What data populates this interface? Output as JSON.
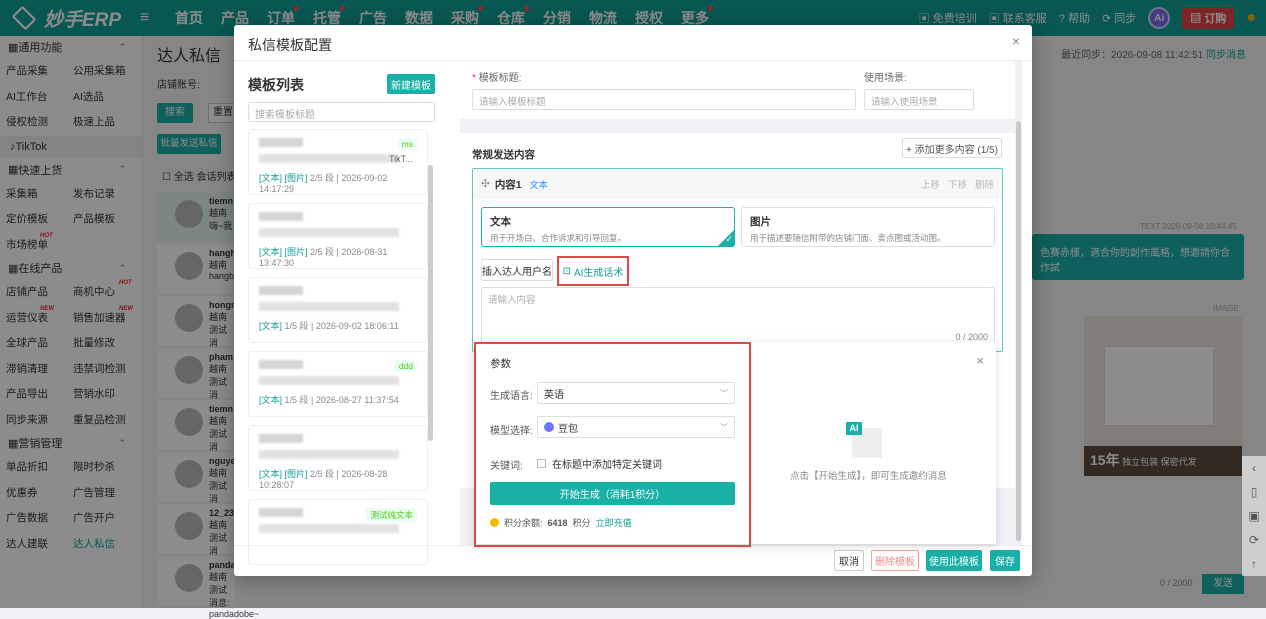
{
  "app": {
    "logo": "妙手ERP"
  },
  "topnav": [
    "首页",
    "产品",
    "订单",
    "托管",
    "广告",
    "数据",
    "采购",
    "仓库",
    "分销",
    "物流",
    "授权",
    "更多"
  ],
  "topright": {
    "training": "免费培训",
    "service": "联系客服",
    "help": "帮助",
    "sync": "同步",
    "ai": "Ai",
    "subscribe": "订购"
  },
  "sidebar": {
    "sections": [
      {
        "title": "通用功能",
        "rows": [
          [
            "产品采集",
            "公用采集箱"
          ],
          [
            "AI工作台",
            "AI选品"
          ],
          [
            "侵权检测",
            "极速上品"
          ]
        ]
      },
      {
        "title": "TikTok",
        "rows": []
      },
      {
        "title": "快速上货",
        "rows": [
          [
            "采集箱",
            "发布记录"
          ],
          [
            "定价模板",
            "产品模板"
          ],
          [
            "市场榜单",
            ""
          ]
        ]
      },
      {
        "title": "在线产品",
        "rows": [
          [
            "店铺产品",
            "商机中心"
          ],
          [
            "运营仪表",
            "销售加速器"
          ],
          [
            "全球产品",
            "批量修改"
          ],
          [
            "滞销清理",
            "违禁词检测"
          ],
          [
            "产品导出",
            "营销水印"
          ],
          [
            "同步来源",
            "重复品检测"
          ]
        ]
      },
      {
        "title": "营销管理",
        "rows": [
          [
            "单品折扣",
            "限时秒杀"
          ],
          [
            "优惠券",
            "广告管理"
          ],
          [
            "广告数据",
            "广告开户"
          ],
          [
            "达人建联",
            "达人私信"
          ]
        ]
      }
    ],
    "badges": {
      "hot": "HOT",
      "new": "NEW"
    }
  },
  "background": {
    "page_title": "达人私信",
    "last_sync": "最近同步：2026-09-08 11:42:51",
    "sync_link": "同步消息",
    "shop_label": "店铺账号:",
    "search": "搜索",
    "reset": "重置",
    "batch_send": "批量发送私信",
    "select_all": "全选",
    "conv_list": "会话列表",
    "chat_ts": "TEXT 2026-09-08 10:44:45",
    "chat_text": "色赛赤樣，適合你的創作風格，想邀請你合作試",
    "image_label": "IMAGE",
    "counter": "0 / 2000",
    "send": "发送",
    "promo": "15年",
    "promo_a": "独立包装",
    "promo_b": "保密代发",
    "rows": [
      {
        "name": "tiemn",
        "sub": "越南",
        "msg": "嗨~我"
      },
      {
        "name": "hangh",
        "sub": "越南",
        "msg": "hangb"
      },
      {
        "name": "hongr",
        "sub": "越南",
        "msg": "测试消"
      },
      {
        "name": "pham",
        "sub": "越南",
        "msg": "测试消"
      },
      {
        "name": "tiemn",
        "sub": "越南",
        "msg": "测试消"
      },
      {
        "name": "nguye",
        "sub": "越南",
        "msg": "测试消"
      },
      {
        "name": "12_23",
        "sub": "越南",
        "msg": "测试消"
      },
      {
        "name": "panda",
        "sub": "越南",
        "msg": "测试消息: pandadobe~"
      }
    ]
  },
  "modal": {
    "title": "私信模板配置",
    "close": "×",
    "list_title": "模板列表",
    "new_template": "新建模板",
    "search_placeholder": "搜索模板标题",
    "templates": [
      {
        "meta_types": "[文本] [图片]",
        "meta_rest": " 2/5 段 | 2026-09-02 14:17:29",
        "tag": "ms",
        "preview": "TikT..."
      },
      {
        "meta_types": "[文本] [图片]",
        "meta_rest": " 2/5 段 | 2026-08-31 13:47:30",
        "tag": "",
        "preview": ""
      },
      {
        "meta_types": "[文本]",
        "meta_rest": " 1/5 段 | 2026-09-02 18:06:11",
        "tag": "",
        "preview": ""
      },
      {
        "meta_types": "[文本]",
        "meta_rest": " 1/5 段 | 2026-08-27 11:37:54",
        "tag": "ddd",
        "preview": ""
      },
      {
        "meta_types": "[文本] [图片]",
        "meta_rest": " 2/5 段 | 2026-08-28 10:28:07",
        "tag": "",
        "preview": ""
      },
      {
        "meta_types": "",
        "meta_rest": "",
        "tag": "测试纯文本",
        "preview": ""
      }
    ],
    "form": {
      "title_label": "模板标题:",
      "title_placeholder": "请输入模板标题",
      "scene_label": "使用场景:",
      "scene_placeholder": "请输入使用场景",
      "section_title": "常规发送内容",
      "add_more": "+ 添加更多内容 (1/5)",
      "content_label": "内容1",
      "content_type": "文本",
      "up": "上移",
      "down": "下移",
      "del": "删除",
      "opt_text_title": "文本",
      "opt_text_desc": "用于开场白、合作诉求和引导回复。",
      "opt_img_title": "图片",
      "opt_img_desc": "用于描述要随信附带的店铺门面、卖点图或活动图。",
      "insert_btn": "插入达人用户名",
      "ai_btn": "AI生成话术",
      "content_placeholder": "请输入内容",
      "counter": "0 / 2000"
    },
    "params": {
      "title": "参数",
      "lang_label": "生成语言:",
      "lang_value": "英语",
      "model_label": "模型选择:",
      "model_value": "豆包",
      "kw_label": "关键词:",
      "kw_check": "在标题中添加特定关键词",
      "gen_btn": "开始生成（消耗1积分）",
      "points_label": "积分余额:",
      "points_value": "6418",
      "points_unit": "积分",
      "recharge": "立即充值",
      "empty_tip": "点击【开始生成】，即可生成邀约消息",
      "ai_mark": "AI"
    },
    "footer": {
      "cancel": "取消",
      "delete": "删除模板",
      "use": "使用此模板",
      "save": "保存"
    }
  }
}
